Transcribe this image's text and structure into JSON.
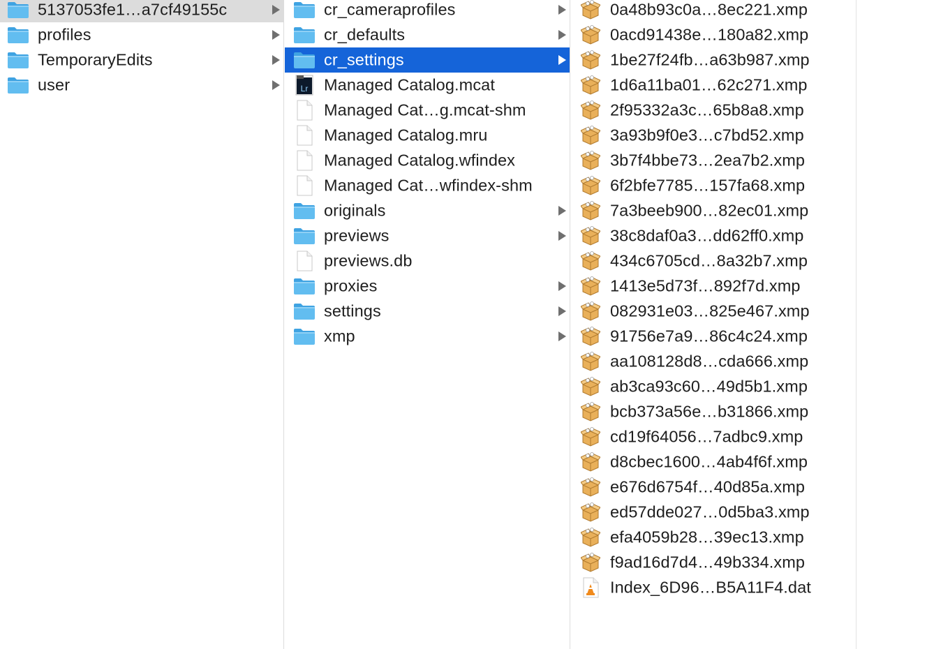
{
  "columns": [
    {
      "items": [
        {
          "name": "5137053fe1…a7cf49155c",
          "icon": "folder-icon",
          "has_arrow": true,
          "selected": "inactive"
        },
        {
          "name": "profiles",
          "icon": "folder-icon",
          "has_arrow": true
        },
        {
          "name": "TemporaryEdits",
          "icon": "folder-icon",
          "has_arrow": true
        },
        {
          "name": "user",
          "icon": "folder-icon",
          "has_arrow": true
        }
      ]
    },
    {
      "items": [
        {
          "name": "cr_cameraprofiles",
          "icon": "folder-icon",
          "has_arrow": true
        },
        {
          "name": "cr_defaults",
          "icon": "folder-icon",
          "has_arrow": true
        },
        {
          "name": "cr_settings",
          "icon": "folder-icon",
          "has_arrow": true,
          "selected": "active"
        },
        {
          "name": "Managed Catalog.mcat",
          "icon": "lightroom-catalog-icon",
          "icon_label": "Lr",
          "has_arrow": false
        },
        {
          "name": "Managed Cat…g.mcat-shm",
          "icon": "document-icon",
          "has_arrow": false
        },
        {
          "name": "Managed Catalog.mru",
          "icon": "document-icon",
          "has_arrow": false
        },
        {
          "name": "Managed Catalog.wfindex",
          "icon": "document-icon",
          "has_arrow": false
        },
        {
          "name": "Managed Cat…wfindex-shm",
          "icon": "document-icon",
          "has_arrow": false
        },
        {
          "name": "originals",
          "icon": "folder-icon",
          "has_arrow": true
        },
        {
          "name": "previews",
          "icon": "folder-icon",
          "has_arrow": true
        },
        {
          "name": "previews.db",
          "icon": "document-icon",
          "has_arrow": false
        },
        {
          "name": "proxies",
          "icon": "folder-icon",
          "has_arrow": true
        },
        {
          "name": "settings",
          "icon": "folder-icon",
          "has_arrow": true
        },
        {
          "name": "xmp",
          "icon": "folder-icon",
          "has_arrow": true
        }
      ]
    },
    {
      "items": [
        {
          "name": "0a48b93c0a…8ec221.xmp",
          "icon": "xmp-file-icon",
          "has_arrow": false
        },
        {
          "name": "0acd91438e…180a82.xmp",
          "icon": "xmp-file-icon",
          "has_arrow": false
        },
        {
          "name": "1be27f24fb…a63b987.xmp",
          "icon": "xmp-file-icon",
          "has_arrow": false
        },
        {
          "name": "1d6a11ba01…62c271.xmp",
          "icon": "xmp-file-icon",
          "has_arrow": false
        },
        {
          "name": "2f95332a3c…65b8a8.xmp",
          "icon": "xmp-file-icon",
          "has_arrow": false
        },
        {
          "name": "3a93b9f0e3…c7bd52.xmp",
          "icon": "xmp-file-icon",
          "has_arrow": false
        },
        {
          "name": "3b7f4bbe73…2ea7b2.xmp",
          "icon": "xmp-file-icon",
          "has_arrow": false
        },
        {
          "name": "6f2bfe7785…157fa68.xmp",
          "icon": "xmp-file-icon",
          "has_arrow": false
        },
        {
          "name": "7a3beeb900…82ec01.xmp",
          "icon": "xmp-file-icon",
          "has_arrow": false
        },
        {
          "name": "38c8daf0a3…dd62ff0.xmp",
          "icon": "xmp-file-icon",
          "has_arrow": false
        },
        {
          "name": "434c6705cd…8a32b7.xmp",
          "icon": "xmp-file-icon",
          "has_arrow": false
        },
        {
          "name": "1413e5d73f…892f7d.xmp",
          "icon": "xmp-file-icon",
          "has_arrow": false
        },
        {
          "name": "082931e03…825e467.xmp",
          "icon": "xmp-file-icon",
          "has_arrow": false
        },
        {
          "name": "91756e7a9…86c4c24.xmp",
          "icon": "xmp-file-icon",
          "has_arrow": false
        },
        {
          "name": "aa108128d8…cda666.xmp",
          "icon": "xmp-file-icon",
          "has_arrow": false
        },
        {
          "name": "ab3ca93c60…49d5b1.xmp",
          "icon": "xmp-file-icon",
          "has_arrow": false
        },
        {
          "name": "bcb373a56e…b31866.xmp",
          "icon": "xmp-file-icon",
          "has_arrow": false
        },
        {
          "name": "cd19f64056…7adbc9.xmp",
          "icon": "xmp-file-icon",
          "has_arrow": false
        },
        {
          "name": "d8cbec1600…4ab4f6f.xmp",
          "icon": "xmp-file-icon",
          "has_arrow": false
        },
        {
          "name": "e676d6754f…40d85a.xmp",
          "icon": "xmp-file-icon",
          "has_arrow": false
        },
        {
          "name": "ed57dde027…0d5ba3.xmp",
          "icon": "xmp-file-icon",
          "has_arrow": false
        },
        {
          "name": "efa4059b28…39ec13.xmp",
          "icon": "xmp-file-icon",
          "has_arrow": false
        },
        {
          "name": "f9ad16d7d4…49b334.xmp",
          "icon": "xmp-file-icon",
          "has_arrow": false
        },
        {
          "name": "Index_6D96…B5A11F4.dat",
          "icon": "vlc-file-icon",
          "has_arrow": false
        }
      ]
    }
  ],
  "colors": {
    "selection_active": "#1564d9",
    "selection_inactive": "#dcdcdc",
    "folder": "#5ab8ee",
    "text": "#1e1e1e"
  }
}
